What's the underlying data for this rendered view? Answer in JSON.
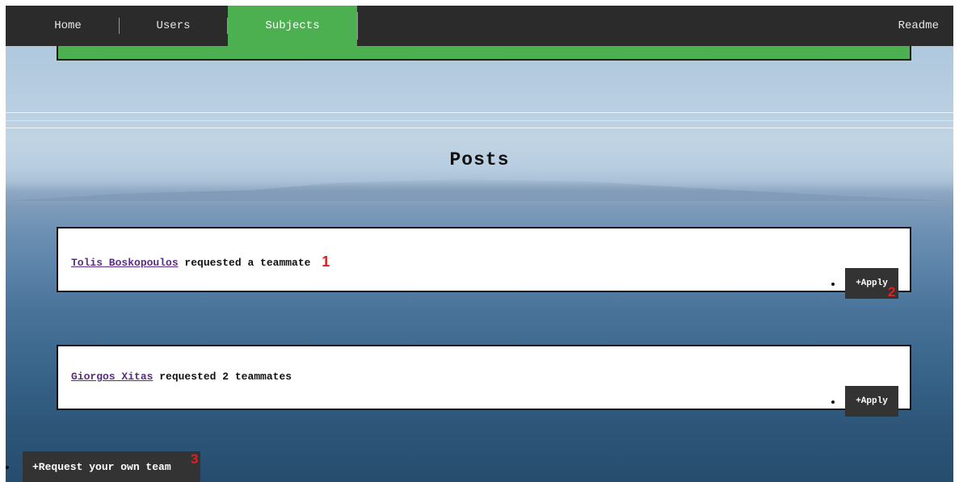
{
  "nav": {
    "items": [
      {
        "label": "Home"
      },
      {
        "label": "Users"
      },
      {
        "label": "Subjects"
      }
    ],
    "readme": "Readme",
    "active_color": "#4caf50",
    "bar_color": "#2b2b2b"
  },
  "page": {
    "title": "Posts"
  },
  "posts": [
    {
      "user": "Tolis Boskopoulos",
      "text": " requested a teammate",
      "marker": "1",
      "apply_label": "+Apply",
      "apply_marker": "2"
    },
    {
      "user": "Giorgos Xitas",
      "text": " requested 2 teammates",
      "apply_label": "+Apply"
    }
  ],
  "request_team": {
    "label": "+Request your own team",
    "marker": "3"
  }
}
